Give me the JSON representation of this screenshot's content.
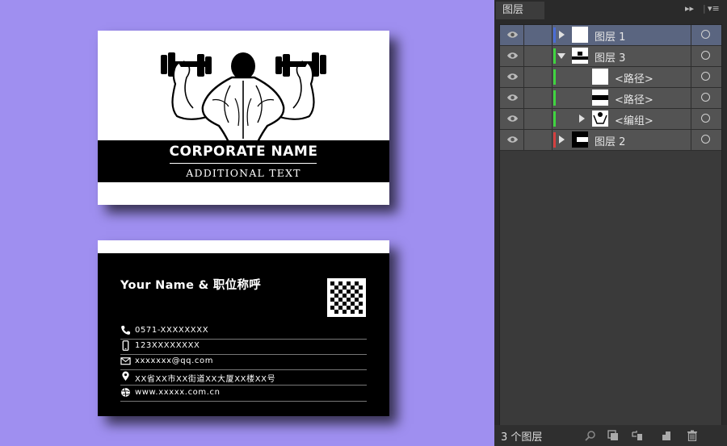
{
  "front_card": {
    "corporate_name": "CORPORATE NAME",
    "additional_text": "ADDITIONAL TEXT"
  },
  "back_card": {
    "name_title": "Your Name & 职位称呼",
    "contacts": [
      {
        "icon": "phone-icon",
        "text": "0571-XXXXXXXX"
      },
      {
        "icon": "mobile-icon",
        "text": "123XXXXXXXX"
      },
      {
        "icon": "email-icon",
        "text": "xxxxxxx@qq.com"
      },
      {
        "icon": "location-pin-icon",
        "text": "XX省XX市XX街道XX大厦XX楼XX号"
      },
      {
        "icon": "globe-icon",
        "text": "www.xxxxx.com.cn"
      }
    ]
  },
  "layers_panel": {
    "tab_title": "图层",
    "layers": [
      {
        "name": "图层 1",
        "color": "#4a6cd4",
        "expanded": false,
        "selected": true
      },
      {
        "name": "图层 3",
        "color": "#3fd43f",
        "expanded": true,
        "selected": false
      },
      {
        "name": "<路径>",
        "color": "#3fd43f",
        "expanded": false,
        "selected": false
      },
      {
        "name": "<路径>",
        "color": "#3fd43f",
        "expanded": false,
        "selected": false
      },
      {
        "name": "<编组>",
        "color": "#3fd43f",
        "expanded": false,
        "selected": false
      },
      {
        "name": "图层 2",
        "color": "#d43f3f",
        "expanded": false,
        "selected": false
      }
    ],
    "footer_count": "3 个图层"
  },
  "colors": {
    "canvas_background": "#9f8ff0",
    "panel_background": "#2a2a2a",
    "layer_row": "#535353",
    "layer_row_selected": "#5a6580"
  }
}
